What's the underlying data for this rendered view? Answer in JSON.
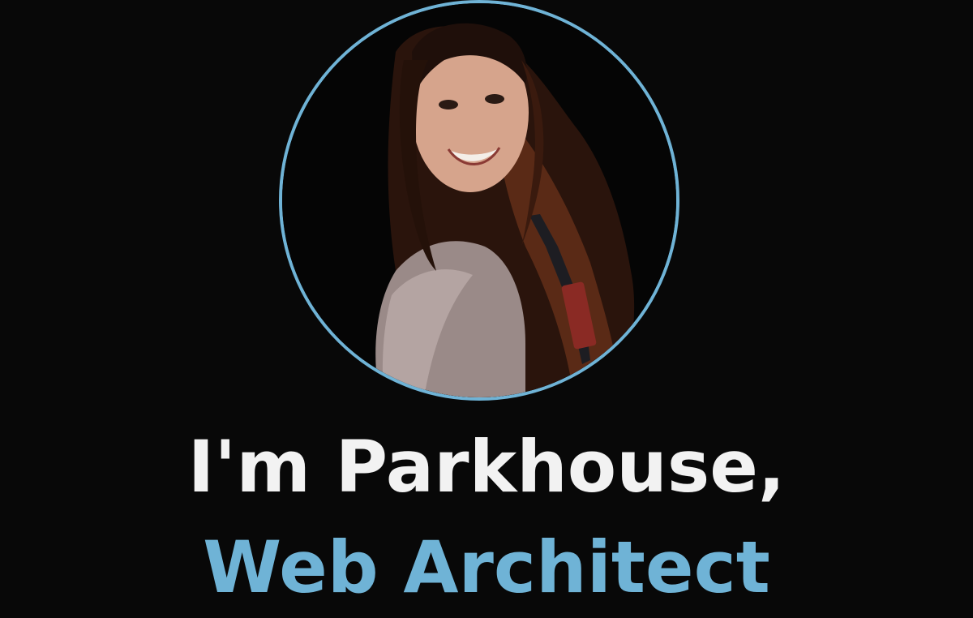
{
  "hero": {
    "greeting": "I'm Parkhouse,",
    "role": "Web Architect",
    "avatar_alt": "Portrait photo",
    "accent_color": "#6fb3d6",
    "background_color": "#080808",
    "text_color": "#f2f2f2"
  }
}
